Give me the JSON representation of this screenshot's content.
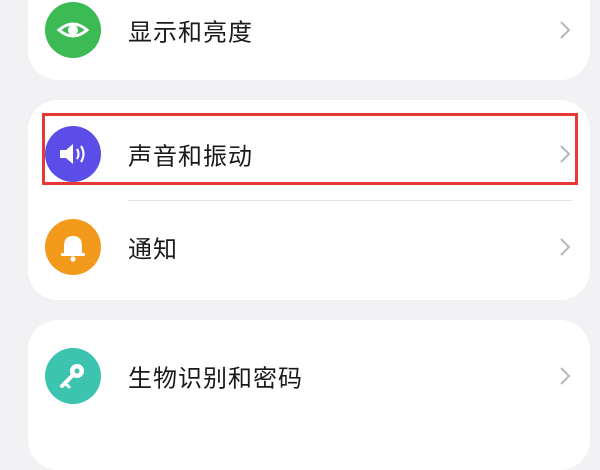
{
  "settings": {
    "items": [
      {
        "label": "显示和亮度",
        "icon": "eye-icon",
        "color": "#3cba54"
      },
      {
        "label": "声音和振动",
        "icon": "speaker-icon",
        "color": "#5b4ee8"
      },
      {
        "label": "通知",
        "icon": "bell-icon",
        "color": "#f39a1c"
      },
      {
        "label": "生物识别和密码",
        "icon": "key-icon",
        "color": "#3dc4b0"
      }
    ]
  },
  "highlight": {
    "color": "#e53935"
  }
}
